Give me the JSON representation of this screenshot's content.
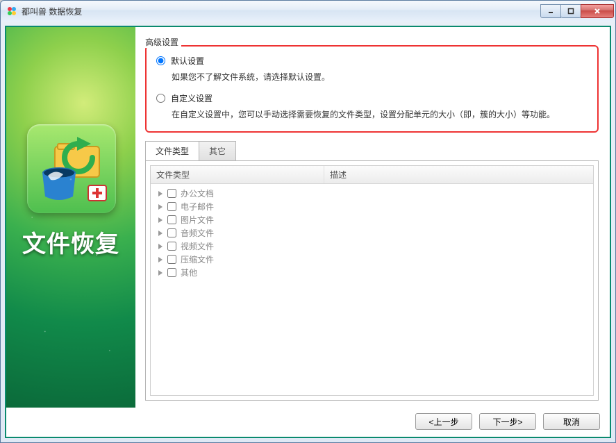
{
  "window": {
    "title": "都叫兽 数据恢复"
  },
  "brand": {
    "title": "文件恢复"
  },
  "fieldset_label": "高级设置",
  "options": {
    "default": {
      "label": "默认设置",
      "desc": "如果您不了解文件系统，请选择默认设置。",
      "selected": true
    },
    "custom": {
      "label": "自定义设置",
      "desc": "在自定义设置中，您可以手动选择需要恢复的文件类型，设置分配单元的大小（即，簇的大小）等功能。",
      "selected": false
    }
  },
  "tabs": {
    "file_type": "文件类型",
    "other": "其它",
    "active": "file_type"
  },
  "tree": {
    "columns": {
      "col1": "文件类型",
      "col2": "描述"
    },
    "items": [
      {
        "label": "办公文档"
      },
      {
        "label": "电子邮件"
      },
      {
        "label": "图片文件"
      },
      {
        "label": "音频文件"
      },
      {
        "label": "视频文件"
      },
      {
        "label": "压缩文件"
      },
      {
        "label": "其他"
      }
    ]
  },
  "buttons": {
    "back": "<上一步",
    "next": "下一步>",
    "cancel": "取消"
  }
}
